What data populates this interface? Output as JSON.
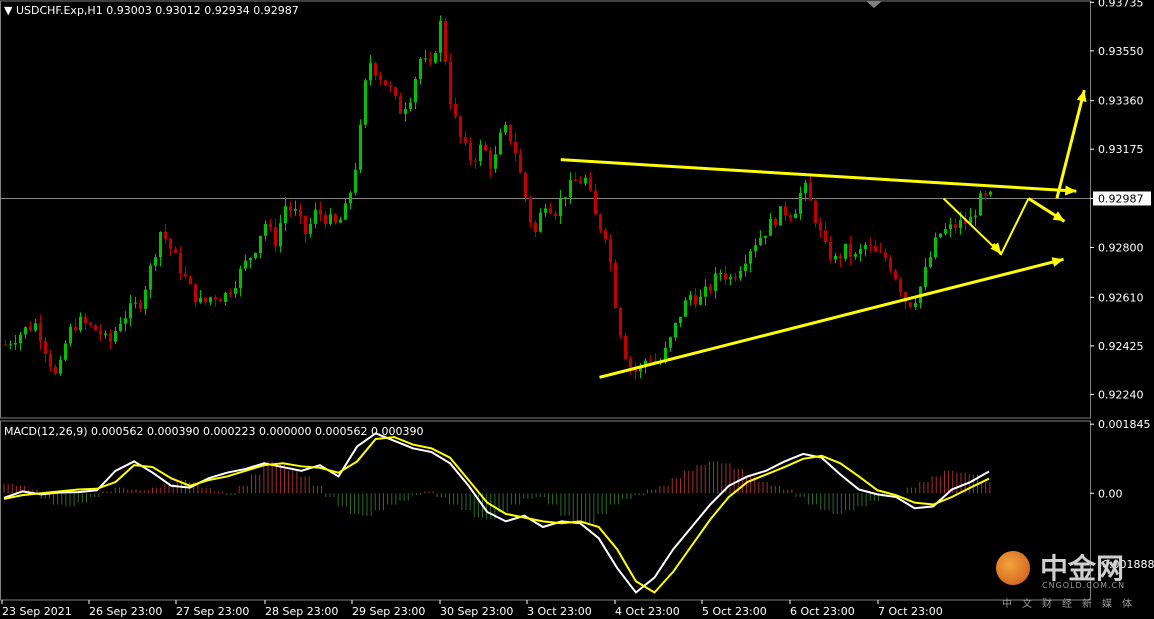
{
  "header": {
    "symbol_label": "USDCHF.Exp,H1",
    "ohlc": [
      "0.93003",
      "0.93012",
      "0.92934",
      "0.92987"
    ]
  },
  "macd_header": {
    "label": "MACD(12,26,9)",
    "values": [
      "0.000562",
      "0.000390",
      "0.000223",
      "0.000000",
      "0.000562",
      "0.000390"
    ]
  },
  "colors": {
    "background": "#000000",
    "bull": "#00c000",
    "bear": "#c00000",
    "trendline": "#ffff00",
    "macd_line": "#ffffff",
    "signal_line": "#ffff00",
    "hist_pos": "#a03030",
    "hist_neg": "#2e6a2e",
    "axis": "#ffffff"
  },
  "watermark": {
    "title": "中金网",
    "subtitle": "CNGOLD.COM.CN",
    "tagline": "中文财经新媒体"
  },
  "chart_data": [
    {
      "type": "candlestick",
      "title": "USDCHF.Exp,H1",
      "ylim": [
        0.9215,
        0.9374
      ],
      "y_ticks": [
        "0.93735",
        "0.93550",
        "0.93360",
        "0.93175",
        "0.92987",
        "0.92800",
        "0.92610",
        "0.92425",
        "0.92240"
      ],
      "current_price": "0.92987",
      "x_ticks": [
        "23 Sep 2021",
        "26 Sep 23:00",
        "27 Sep 23:00",
        "28 Sep 23:00",
        "29 Sep 23:00",
        "30 Sep 23:00",
        "3 Oct 23:00",
        "4 Oct 23:00",
        "5 Oct 23:00",
        "6 Oct 23:00",
        "7 Oct 23:00"
      ],
      "close_path": [
        0.9243,
        0.9246,
        0.9249,
        0.9251,
        0.924,
        0.9229,
        0.9247,
        0.9252,
        0.925,
        0.9248,
        0.9243,
        0.9252,
        0.9256,
        0.9259,
        0.9272,
        0.9287,
        0.9279,
        0.9271,
        0.9263,
        0.9258,
        0.9262,
        0.9261,
        0.9266,
        0.9273,
        0.9279,
        0.929,
        0.9282,
        0.9296,
        0.9293,
        0.9285,
        0.9294,
        0.9291,
        0.9288,
        0.9296,
        0.9316,
        0.9352,
        0.9346,
        0.9341,
        0.9332,
        0.9337,
        0.9352,
        0.9348,
        0.9366,
        0.9334,
        0.932,
        0.9313,
        0.9319,
        0.931,
        0.9326,
        0.932,
        0.9302,
        0.9284,
        0.9298,
        0.9294,
        0.9301,
        0.9305,
        0.9306,
        0.929,
        0.9285,
        0.9254,
        0.9236,
        0.9232,
        0.9239,
        0.9235,
        0.9243,
        0.9254,
        0.9262,
        0.926,
        0.9265,
        0.9271,
        0.9268,
        0.9274,
        0.9281,
        0.9285,
        0.929,
        0.9294,
        0.9293,
        0.9304,
        0.9293,
        0.928,
        0.9275,
        0.9279,
        0.9276,
        0.9281,
        0.9277,
        0.9276,
        0.9268,
        0.9258,
        0.9262,
        0.9274,
        0.9285,
        0.9287,
        0.9289,
        0.929,
        0.9298,
        0.9299
      ],
      "annotations": {
        "resistance_line": [
          [
            0.5145,
            0.93135
          ],
          [
            0.9874,
            0.93015
          ]
        ],
        "support_line": [
          [
            0.5518,
            0.92305
          ],
          [
            0.9757,
            0.92755
          ]
        ],
        "horizontal_price_line": 0.92987,
        "projection_path": [
          [
            0.8657,
            0.92987
          ],
          [
            0.9185,
            0.92775
          ],
          [
            0.9436,
            0.92987
          ],
          [
            0.9766,
            0.929
          ]
        ],
        "projection_arrow_up": [
          [
            0.9696,
            0.92987
          ],
          [
            0.9948,
            0.934
          ]
        ]
      }
    },
    {
      "type": "line",
      "title": "MACD(12,26,9)",
      "ylim": [
        -0.00285,
        0.00193
      ],
      "y_ticks": [
        "0.001845",
        "0.00",
        "-0.001888"
      ],
      "series": [
        {
          "values": [
            -0.00012,
            5e-05,
            -3e-05,
            2e-05,
            3e-05,
            8e-05,
            0.0006,
            0.00085,
            0.00055,
            0.0002,
            0.00015,
            0.0004,
            0.00055,
            0.00065,
            0.0008,
            0.0007,
            0.0006,
            0.00075,
            0.00045,
            0.00125,
            0.0016,
            0.0014,
            0.0012,
            0.0011,
            0.0008,
            0.0002,
            -0.0005,
            -0.00075,
            -0.0006,
            -0.0009,
            -0.00075,
            -0.0008,
            -0.0012,
            -0.002,
            -0.00265,
            -0.00225,
            -0.0015,
            -0.0009,
            -0.0003,
            0.0002,
            0.00045,
            0.0006,
            0.00085,
            0.00105,
            0.00095,
            0.0005,
            0.0001,
            -3e-05,
            -0.0001,
            -0.0004,
            -0.00035,
            0.0001,
            0.0003,
            0.00058
          ]
        },
        {
          "values": [
            -0.00015,
            -5e-05,
            0.0,
            5e-05,
            0.0001,
            0.00012,
            0.0003,
            0.00075,
            0.0007,
            0.0004,
            0.0002,
            0.00035,
            0.00045,
            0.0006,
            0.00075,
            0.0008,
            0.00072,
            0.00068,
            0.00055,
            0.00085,
            0.00145,
            0.0015,
            0.0013,
            0.0012,
            0.00095,
            0.00035,
            -0.00025,
            -0.00055,
            -0.00065,
            -0.00075,
            -0.0008,
            -0.00075,
            -0.0009,
            -0.0015,
            -0.00235,
            -0.00265,
            -0.0021,
            -0.0014,
            -0.0007,
            -0.0001,
            0.0003,
            0.0005,
            0.0007,
            0.00092,
            0.001,
            0.0008,
            0.00045,
            8e-05,
            -5e-05,
            -0.00025,
            -0.0003,
            -0.0001,
            0.00015,
            0.00039
          ]
        }
      ],
      "histogram": [
        0.00025,
        0.0002,
        0.0001,
        -0.00015,
        -0.0003,
        -0.00035,
        -0.00025,
        -0.0001,
        5e-05,
        0.00015,
        0.0001,
        8e-05,
        0.00015,
        0.00025,
        0.00035,
        0.0003,
        0.00015,
        5e-05,
        -5e-05,
        0.0002,
        0.0005,
        0.00085,
        0.0008,
        0.0006,
        0.00045,
        0.0002,
        -0.0001,
        -0.00035,
        -0.00055,
        -0.0006,
        -0.00045,
        -0.0003,
        -0.0002,
        -5e-05,
        5e-05,
        -0.0001,
        -0.0003,
        -0.00045,
        -0.00065,
        -0.0007,
        -0.0005,
        -0.0003,
        -0.00015,
        -0.0001,
        -0.0003,
        -0.0006,
        -0.00075,
        -0.0008,
        -0.00055,
        -0.0003,
        -0.00015,
        -5e-05,
        0.0001,
        0.0002,
        0.0004,
        0.0006,
        0.00075,
        0.00085,
        0.0008,
        0.00065,
        0.00045,
        0.0003,
        0.0002,
        0.0001,
        -0.0001,
        -0.0003,
        -0.00045,
        -0.00055,
        -0.00045,
        -0.00035,
        -0.0002,
        -0.0001,
        0.0,
        0.00015,
        0.0003,
        0.00045,
        0.0006,
        0.00055,
        0.0005,
        0.0003
      ]
    }
  ]
}
